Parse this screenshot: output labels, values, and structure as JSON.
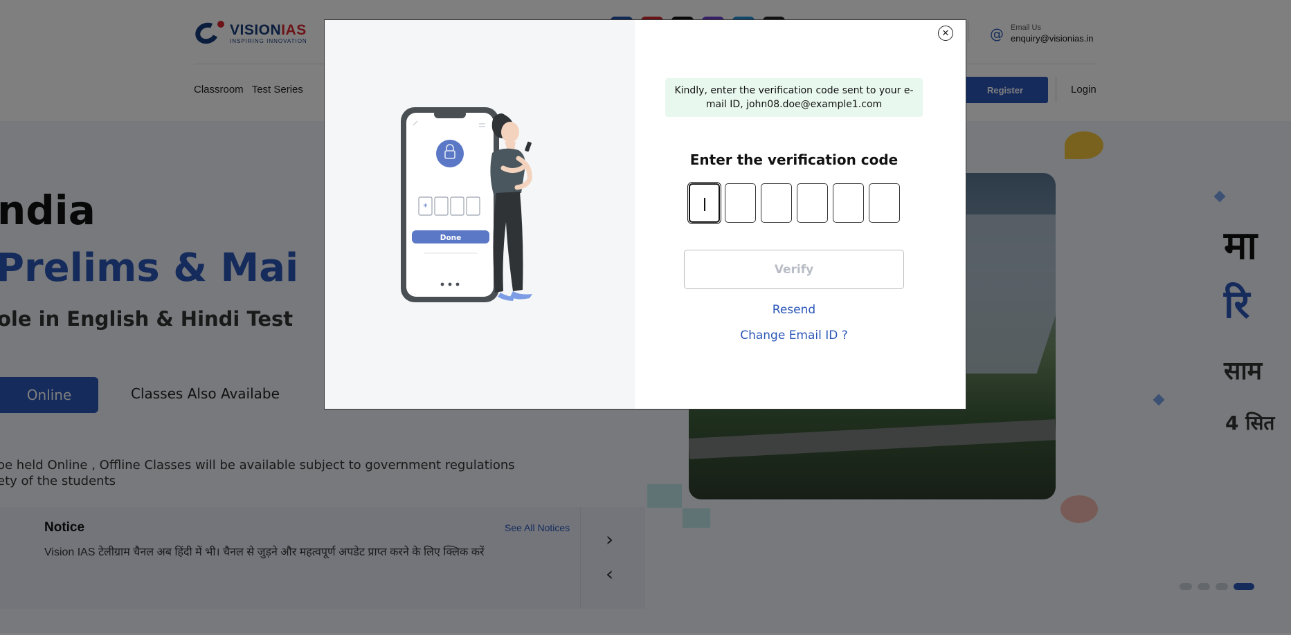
{
  "header": {
    "brand_name_part1": "VISION",
    "brand_name_part2": "IAS",
    "brand_tagline": "INSPIRING INNOVATION",
    "email_label": "Email Us",
    "email_value": "enquiry@visionias.in",
    "social_colors": [
      "#1e50a8",
      "#d3262b",
      "#111111",
      "#6b3fd1",
      "#1b8fd8",
      "#222222"
    ]
  },
  "nav": {
    "items": [
      "Classroom",
      "Test Series"
    ],
    "register_label": "Register",
    "login_label": "Login"
  },
  "hero": {
    "line1": "ndia",
    "line2": "Prelims & Mai",
    "line3": "ole in English & Hindi Test",
    "online_button": "Online",
    "classes_text": "Classes Also Availabe",
    "note_line1": "oe held Online , Offline Classes will be available subject to government regulations",
    "note_line2": "ety of the students",
    "hindi_line1": "मा",
    "hindi_line2": "रि",
    "hindi_line3": "साम",
    "hindi_line4": "4 सित"
  },
  "notice": {
    "title": "Notice",
    "see_all_label": "See All Notices",
    "text": "Vision IAS टेलीग्राम चैनल अब हिंदी में भी। चैनल से जुड़ने और महत्वपूर्ण अपडेट प्राप्त करने के लिए क्लिक करें",
    "next_icon": "chevron-right-icon",
    "prev_icon": "chevron-left-icon"
  },
  "carousel": {
    "dot_count": 4,
    "active_index": 3
  },
  "modal": {
    "close_icon": "close-icon",
    "close_glyph": "✕",
    "info_message": "Kindly, enter the verification code sent to your e-mail ID, john08.doe@example1.com",
    "title": "Enter the verification code",
    "code_digits": [
      "",
      "",
      "",
      "",
      "",
      ""
    ],
    "verify_label": "Verify",
    "resend_label": "Resend",
    "change_email_label": "Change Email ID ?",
    "illustration": {
      "done_label": "Done"
    }
  },
  "colors": {
    "brand_blue": "#2b56b8",
    "brand_red": "#d9272e",
    "info_bg": "#e9f8ef",
    "link": "#2b56b8"
  }
}
